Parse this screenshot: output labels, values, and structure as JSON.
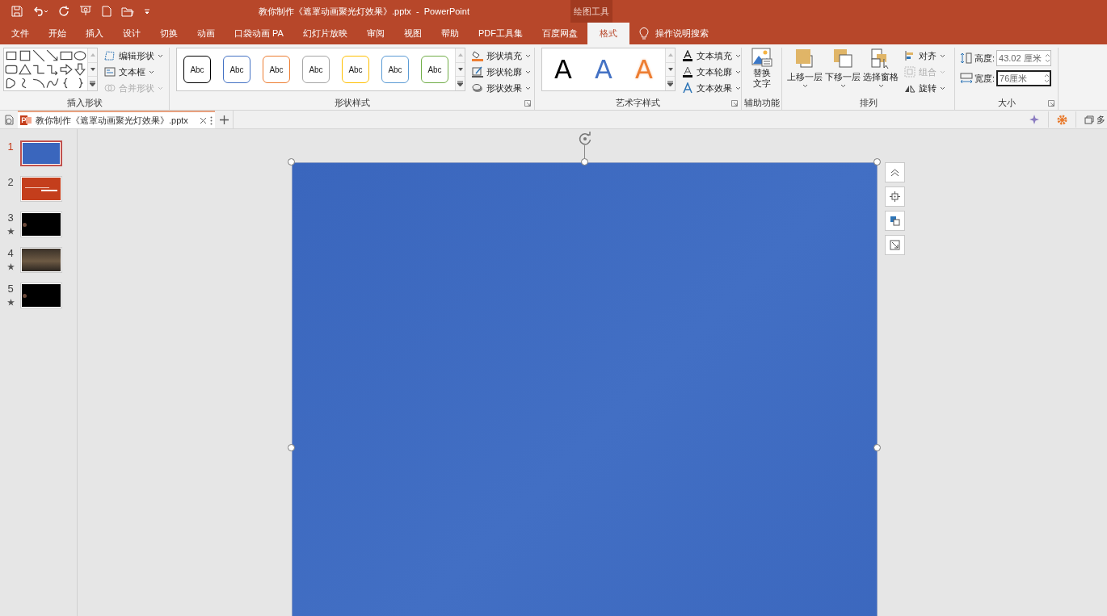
{
  "window": {
    "title": "教你制作《遮罩动画聚光灯效果》.pptx  -  PowerPoint",
    "contextual_label": "绘图工具"
  },
  "tabs": [
    {
      "label": "文件",
      "selected": false
    },
    {
      "label": "开始",
      "selected": false
    },
    {
      "label": "插入",
      "selected": false
    },
    {
      "label": "设计",
      "selected": false
    },
    {
      "label": "切换",
      "selected": false
    },
    {
      "label": "动画",
      "selected": false
    },
    {
      "label": "口袋动画 PA",
      "selected": false
    },
    {
      "label": "幻灯片放映",
      "selected": false
    },
    {
      "label": "审阅",
      "selected": false
    },
    {
      "label": "视图",
      "selected": false
    },
    {
      "label": "帮助",
      "selected": false
    },
    {
      "label": "PDF工具集",
      "selected": false
    },
    {
      "label": "百度网盘",
      "selected": false
    },
    {
      "label": "格式",
      "selected": true
    }
  ],
  "tell_me": "操作说明搜索",
  "ribbon": {
    "insert_shapes": {
      "label": "插入形状",
      "commands": [
        {
          "label": "编辑形状",
          "disabled": false
        },
        {
          "label": "文本框",
          "disabled": false
        },
        {
          "label": "合并形状",
          "disabled": true
        }
      ]
    },
    "shape_styles": {
      "label": "形状样式",
      "swatches": [
        {
          "label": "Abc",
          "color": "#000000"
        },
        {
          "label": "Abc",
          "color": "#4472c4"
        },
        {
          "label": "Abc",
          "color": "#ed7d31"
        },
        {
          "label": "Abc",
          "color": "#a5a5a5"
        },
        {
          "label": "Abc",
          "color": "#ffc000"
        },
        {
          "label": "Abc",
          "color": "#5b9bd5"
        },
        {
          "label": "Abc",
          "color": "#70ad47"
        }
      ],
      "commands": [
        {
          "label": "形状填充",
          "disabled": false
        },
        {
          "label": "形状轮廓",
          "disabled": false
        },
        {
          "label": "形状效果",
          "disabled": false
        }
      ]
    },
    "wordart_styles": {
      "label": "艺术字样式",
      "letters": [
        {
          "label": "A",
          "color": "#000000",
          "kind": "solid"
        },
        {
          "label": "A",
          "color": "#4472c4",
          "kind": "solid"
        },
        {
          "label": "A",
          "color": "#ed7d31",
          "kind": "outline"
        }
      ],
      "commands": [
        {
          "label": "文本填充",
          "disabled": false
        },
        {
          "label": "文本轮廓",
          "disabled": false
        },
        {
          "label": "文本效果",
          "disabled": false
        }
      ]
    },
    "accessibility": {
      "label": "辅助功能",
      "button": "替换文字"
    },
    "arrange": {
      "label": "排列",
      "large_buttons": [
        "上移一层",
        "下移一层",
        "选择窗格"
      ],
      "commands": [
        {
          "label": "对齐",
          "disabled": false
        },
        {
          "label": "组合",
          "disabled": true
        },
        {
          "label": "旋转",
          "disabled": false
        }
      ]
    },
    "size": {
      "label": "大小",
      "height": {
        "label": "高度:",
        "value": "43.02 厘米"
      },
      "width": {
        "label": "宽度:",
        "value": "76厘米"
      }
    }
  },
  "doc_tab": {
    "title": "教你制作《遮罩动画聚光灯效果》.pptx"
  },
  "doc_bar_right": "多",
  "slides": [
    {
      "number": "1",
      "selected": true,
      "animated": false,
      "kind": "blue"
    },
    {
      "number": "2",
      "selected": false,
      "animated": false,
      "kind": "title"
    },
    {
      "number": "3",
      "selected": false,
      "animated": true,
      "kind": "dark"
    },
    {
      "number": "4",
      "selected": false,
      "animated": true,
      "kind": "photo"
    },
    {
      "number": "5",
      "selected": false,
      "animated": true,
      "kind": "dark"
    }
  ]
}
